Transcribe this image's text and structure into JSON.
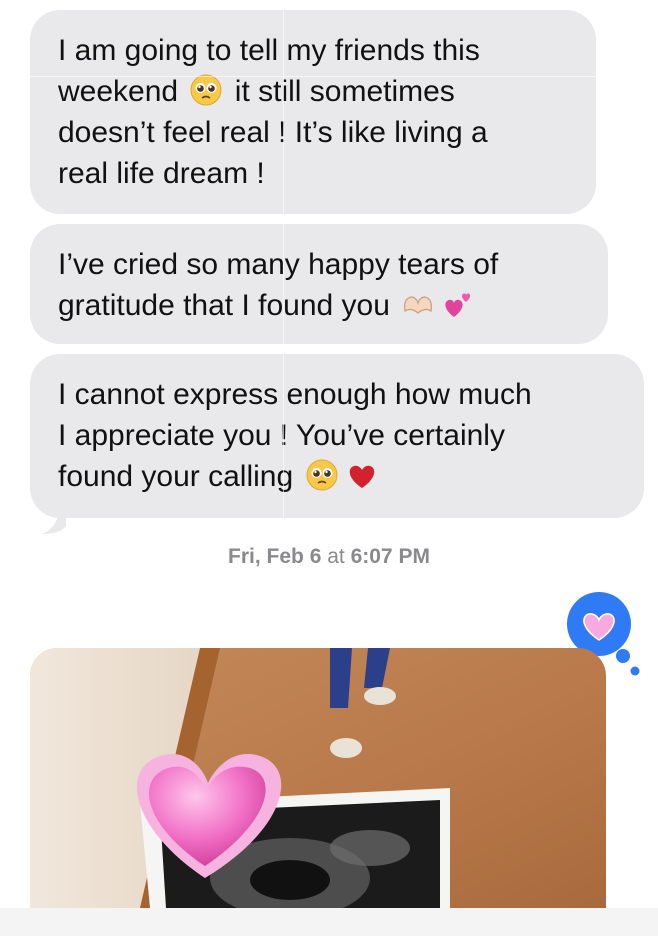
{
  "messages": [
    {
      "text": "I am going to tell my friends this weekend 🥹 it still sometimes doesn’t feel real ! It’s like living a real life dream !"
    },
    {
      "text": "I’ve cried so many happy tears of gratitude that I found you 🫶🏻💕"
    },
    {
      "text": "I cannot express enough how much I appreciate you ! You’ve certainly found your calling 🥹❤️"
    }
  ],
  "timestamp": {
    "day": "Fri, Feb 6",
    "at": " at ",
    "time": "6:07 PM"
  },
  "reaction": {
    "icon": "heart-icon",
    "color": "#2f7bf5"
  },
  "photo": {
    "overlay_icon": "pink-heart-icon"
  },
  "colors": {
    "bubble": "#e9e9eb",
    "reaction_blue": "#2f7bf5",
    "heart_pink": "#f7a8d8"
  }
}
